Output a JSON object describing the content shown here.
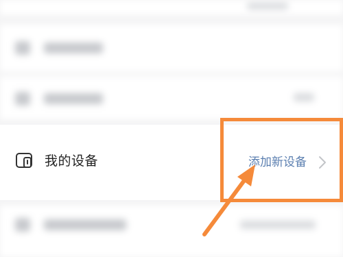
{
  "settings": {
    "device_row": {
      "label": "我的设备",
      "action_label": "添加新设备",
      "icon": "device-icon",
      "chevron": "chevron-right-icon"
    }
  },
  "annotation": {
    "highlight_color": "#f58a3a",
    "arrow": "pointer-arrow-icon"
  },
  "colors": {
    "background": "#f4f4f5",
    "row_background": "#ffffff",
    "label_text": "#222222",
    "action_link": "#5b7fb0"
  }
}
